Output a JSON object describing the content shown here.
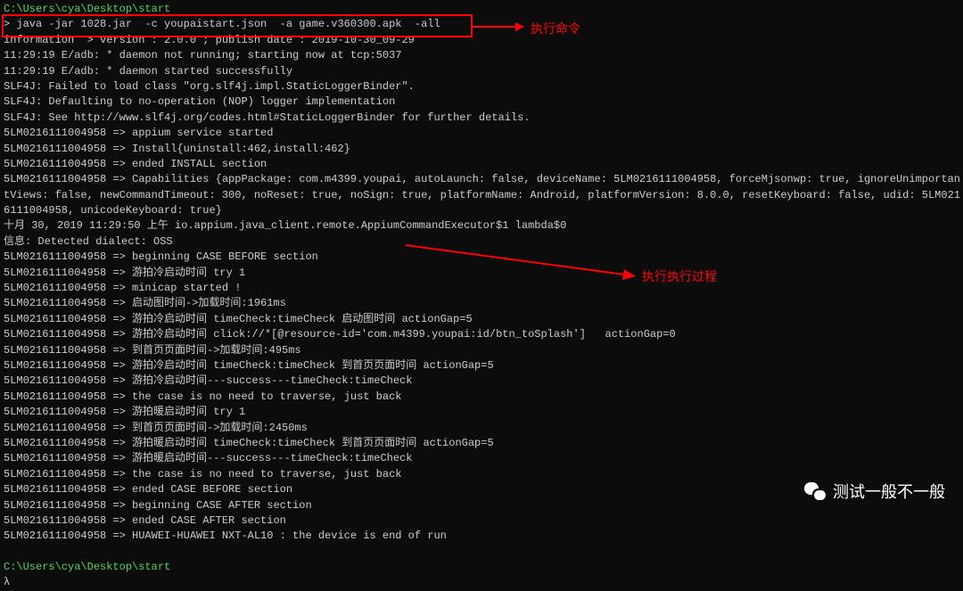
{
  "prompt_path": "C:\\Users\\cya\\Desktop\\start",
  "command": "> java -jar 1028.jar  -c youpaistart.json  -a game.v360300.apk  -all",
  "info_line": "information  > version : 2.0.0 ; publish date : 2019-10-30_09-29",
  "adb1": "11:29:19 E/adb: * daemon not running; starting now at tcp:5037",
  "adb2": "11:29:19 E/adb: * daemon started successfully",
  "slf4j1": "SLF4J: Failed to load class \"org.slf4j.impl.StaticLoggerBinder\".",
  "slf4j2": "SLF4J: Defaulting to no-operation (NOP) logger implementation",
  "slf4j3": "SLF4J: See http://www.slf4j.org/codes.html#StaticLoggerBinder for further details.",
  "svc1": "5LM0216111004958 => appium service started",
  "svc2": "5LM0216111004958 => Install{uninstall:462,install:462}",
  "svc3": "5LM0216111004958 => ended INSTALL section",
  "caps1": "5LM0216111004958 => Capabilities {appPackage: com.m4399.youpai, autoLaunch: false, deviceName: 5LM0216111004958, forceMjsonwp: true, ignoreUnimportan",
  "caps2": "tViews: false, newCommandTimeout: 300, noReset: true, noSign: true, platformName: Android, platformVersion: 8.0.0, resetKeyboard: false, udid: 5LM021",
  "caps3": "6111004958, unicodeKeyboard: true}",
  "appium_line": "十月 30, 2019 11:29:50 上午 io.appium.java_client.remote.AppiumCommandExecutor$1 lambda$0",
  "dialect": "信息: Detected dialect: OSS",
  "l01": "5LM0216111004958 => beginning CASE BEFORE section",
  "l02": "5LM0216111004958 => 游拍冷启动时间 try 1",
  "l03": "5LM0216111004958 => minicap started !",
  "l04": "5LM0216111004958 => 启动图时间->加载时间:1961ms",
  "l05": "5LM0216111004958 => 游拍冷启动时间 timeCheck:timeCheck 启动图时间 actionGap=5",
  "l06": "5LM0216111004958 => 游拍冷启动时间 click://*[@resource-id='com.m4399.youpai:id/btn_toSplash']   actionGap=0",
  "l07": "5LM0216111004958 => 到首页页面时间->加载时间:495ms",
  "l08": "5LM0216111004958 => 游拍冷启动时间 timeCheck:timeCheck 到首页页面时间 actionGap=5",
  "l09": "5LM0216111004958 => 游拍冷启动时间---success---timeCheck:timeCheck",
  "l10": "5LM0216111004958 => the case is no need to traverse, just back",
  "l11": "5LM0216111004958 => 游拍暖启动时间 try 1",
  "l12": "5LM0216111004958 => 到首页页面时间->加载时间:2450ms",
  "l13": "5LM0216111004958 => 游拍暖启动时间 timeCheck:timeCheck 到首页页面时间 actionGap=5",
  "l14": "5LM0216111004958 => 游拍暖启动时间---success---timeCheck:timeCheck",
  "l15": "5LM0216111004958 => the case is no need to traverse, just back",
  "l16": "5LM0216111004958 => ended CASE BEFORE section",
  "l17": "5LM0216111004958 => beginning CASE AFTER section",
  "l18": "5LM0216111004958 => ended CASE AFTER section",
  "l19": "5LM0216111004958 => HUAWEI-HUAWEI NXT-AL10 : the device is end of run",
  "prompt_path2": "C:\\Users\\cya\\Desktop\\start",
  "cursor": "λ ",
  "anno1": "执行命令",
  "anno2": "执行执行过程",
  "watermark": "测试一般不一般"
}
